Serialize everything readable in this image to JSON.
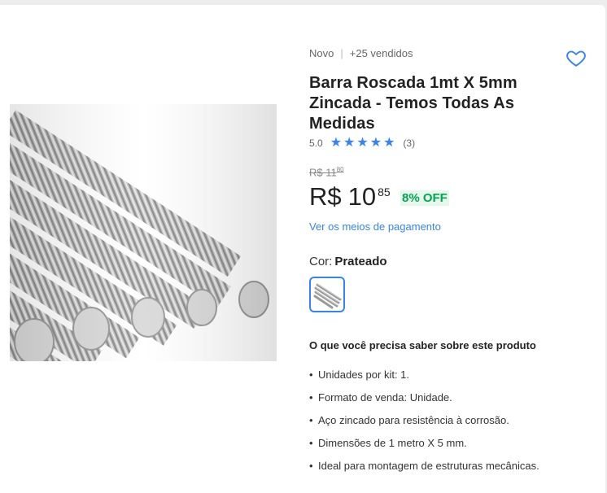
{
  "product": {
    "condition": "Novo",
    "sold": "+25 vendidos",
    "title": "Barra Roscada 1mt X 5mm Zincada - Temos Todas As Medidas",
    "rating_value": "5.0",
    "rating_stars": 5,
    "rating_count": "(3)",
    "old_price_int": "R$ 11",
    "old_price_cents": "80",
    "price_currency": "R$",
    "price_int": "10",
    "price_cents": "85",
    "discount": "8% OFF",
    "payment_link": "Ver os meios de pagamento",
    "color_label": "Cor:",
    "color_value": "Prateado",
    "info_title": "O que você precisa saber sobre este produto",
    "features": [
      "Unidades por kit: 1.",
      "Formato de venda: Unidade.",
      "Aço zincado para resistência à corrosão.",
      "Dimensões de 1 metro X 5 mm.",
      "Ideal para montagem de estruturas mecânicas."
    ]
  },
  "icons": {
    "favorite": "heart-icon",
    "star": "star-icon",
    "product_image": "threaded-rods-image"
  },
  "colors": {
    "accent": "#3483fa",
    "discount_text": "#00a650",
    "discount_bg": "#e6f7ec"
  }
}
